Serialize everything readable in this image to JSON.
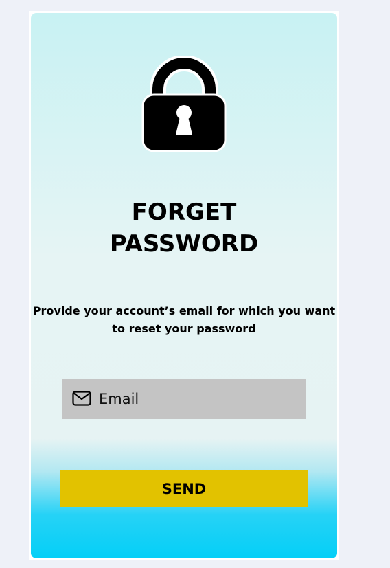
{
  "reset_card": {
    "lock_icon": "lock-icon",
    "title_line1": "FORGET",
    "title_line2": "PASSWORD",
    "instructions_line1": "Provide your account’s email for which you want",
    "instructions_line2": "to reset your password",
    "email_field": {
      "icon": "envelope-icon",
      "value": "",
      "placeholder": "Email"
    },
    "send_button_label": "SEND"
  },
  "colors": {
    "page_background": "#eef1f8",
    "card_top": "#c8f2f3",
    "card_middle": "#e6f4f4",
    "card_bottom": "#04cff7",
    "input_background": "#c4c4c4",
    "button_background": "#e2c200",
    "text": "#000000"
  }
}
